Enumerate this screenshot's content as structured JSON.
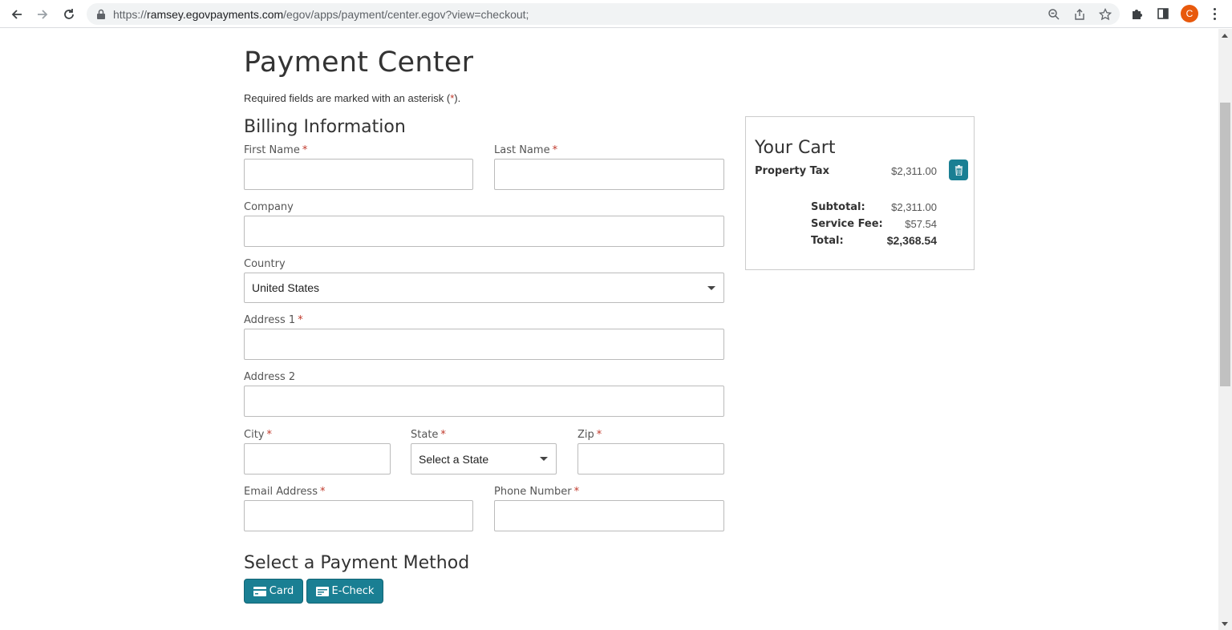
{
  "browser": {
    "url_prefix": "https://",
    "url_host": "ramsey.egovpayments.com",
    "url_path": "/egov/apps/payment/center.egov?view=checkout;",
    "avatar_letter": "C"
  },
  "page": {
    "title": "Payment Center",
    "required_note": "Required fields are marked with an asterisk (",
    "required_note_asterisk": "*",
    "required_note_end": ")."
  },
  "billing": {
    "title": "Billing Information",
    "required_marker": "*",
    "first_name_label": "First Name",
    "last_name_label": "Last Name",
    "company_label": "Company",
    "country_label": "Country",
    "country_value": "United States",
    "address1_label": "Address 1",
    "address2_label": "Address 2",
    "city_label": "City",
    "state_label": "State",
    "state_value": "Select a State",
    "zip_label": "Zip",
    "email_label": "Email Address",
    "phone_label": "Phone Number"
  },
  "cart": {
    "title": "Your Cart",
    "item_name": "Property Tax",
    "item_amount": "$2,311.00",
    "subtotal_label": "Subtotal:",
    "subtotal_value": "$2,311.00",
    "service_fee_label": "Service Fee:",
    "service_fee_value": "$57.54",
    "total_label": "Total:",
    "total_value": "$2,368.54"
  },
  "payment": {
    "title": "Select a Payment Method",
    "card_label": "Card",
    "echeck_label": "E-Check"
  },
  "colors": {
    "accent": "#1a7f93",
    "required": "#c0392b"
  }
}
